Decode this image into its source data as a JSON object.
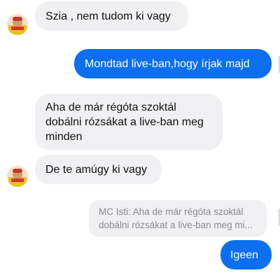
{
  "conversation": {
    "messages": [
      {
        "sender": "contact",
        "text": "Szia , nem tudom ki vagy"
      },
      {
        "sender": "me",
        "text": "Mondtad live-ban,hogy írjak majd"
      },
      {
        "sender": "contact",
        "text": "Aha de már régóta szoktál\ndobálni rózsákat a live-ban meg\nminden"
      },
      {
        "sender": "contact",
        "text": "De te amúgy ki vagy"
      }
    ],
    "reply": {
      "quoted": "MC Isti: Aha de már régóta szoktál\ndobálni rózsákat a live-ban meg mi...",
      "text": "Igeen"
    }
  },
  "colors": {
    "outgoing_bubble": "#0b6ff0",
    "incoming_bubble": "#f0f0f2",
    "quoted_text": "#8a8a8e"
  },
  "icons": {
    "avatar": "contact-avatar-icon"
  }
}
